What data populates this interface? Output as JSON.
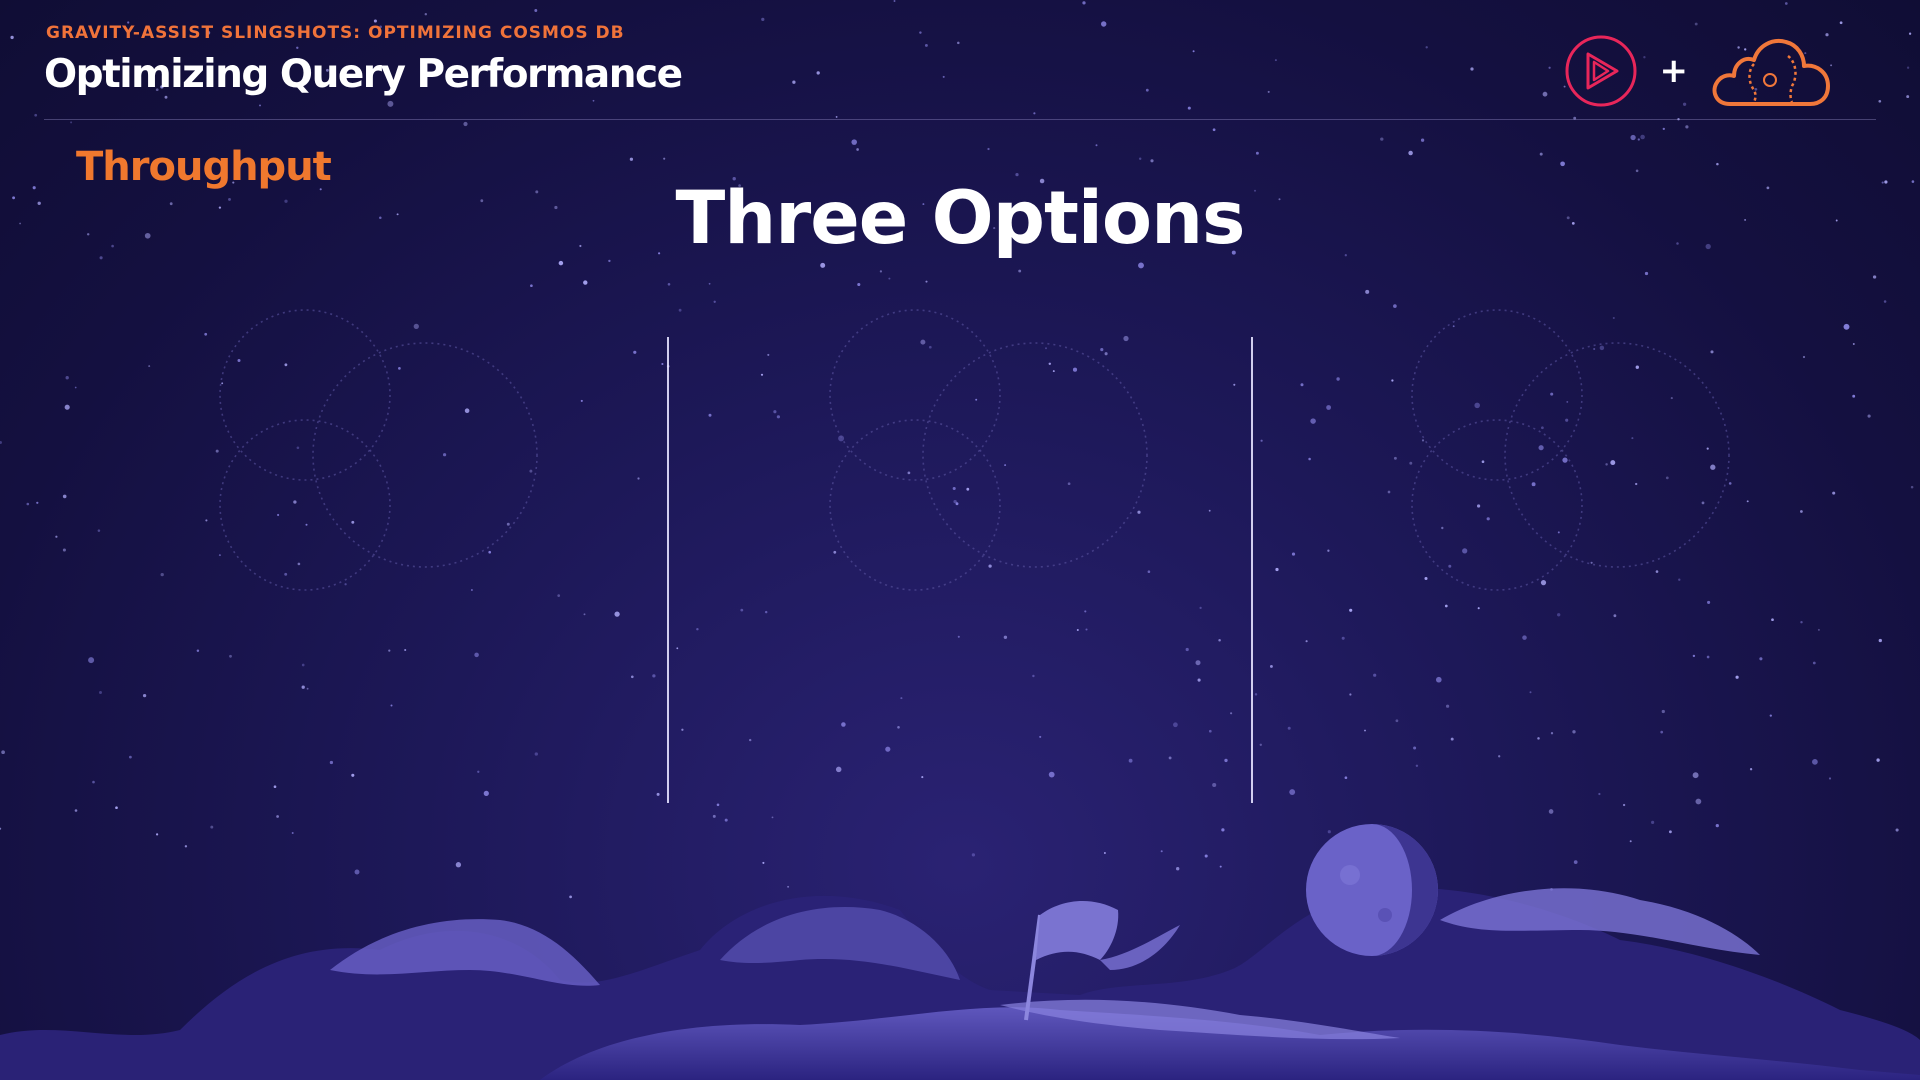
{
  "header": {
    "eyebrow": "GRAVITY-ASSIST SLINGSHOTS: OPTIMIZING COSMOS DB",
    "title": "Optimizing Query Performance",
    "plus_sign": "+",
    "logos": [
      "pluralsight-play-icon",
      "cloud-brain-icon"
    ]
  },
  "slide": {
    "section_label": "Throughput",
    "title": "Three Options"
  },
  "colors": {
    "background": "#1d1858",
    "accent_orange": "#f0733a",
    "logo_red": "#e8265a",
    "text_white": "#ffffff",
    "moon_purple": "#6a62c8"
  },
  "decorations": [
    "venn-diagram-icon",
    "venn-diagram-icon",
    "venn-diagram-icon",
    "moon-landscape",
    "planet",
    "flag"
  ]
}
